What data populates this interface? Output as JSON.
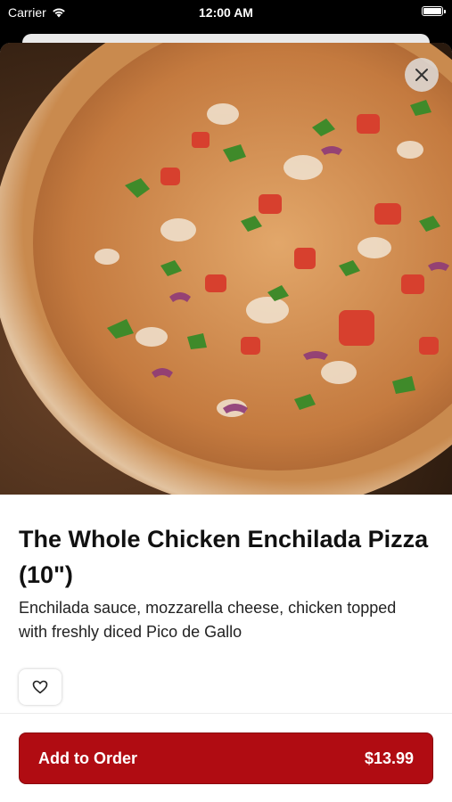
{
  "status_bar": {
    "carrier": "Carrier",
    "time": "12:00 AM"
  },
  "item": {
    "title": "The Whole Chicken Enchilada Pizza (10\")",
    "description": "Enchilada sauce, mozzarella cheese, chicken topped with freshly diced Pico de Gallo",
    "image_icon": "pizza-photo"
  },
  "icons": {
    "close": "close-icon",
    "favorite": "heart-icon"
  },
  "cta": {
    "label": "Add to Order",
    "price": "$13.99"
  },
  "colors": {
    "accent": "#b00c12",
    "background": "#ffffff",
    "status_bar": "#000000"
  }
}
